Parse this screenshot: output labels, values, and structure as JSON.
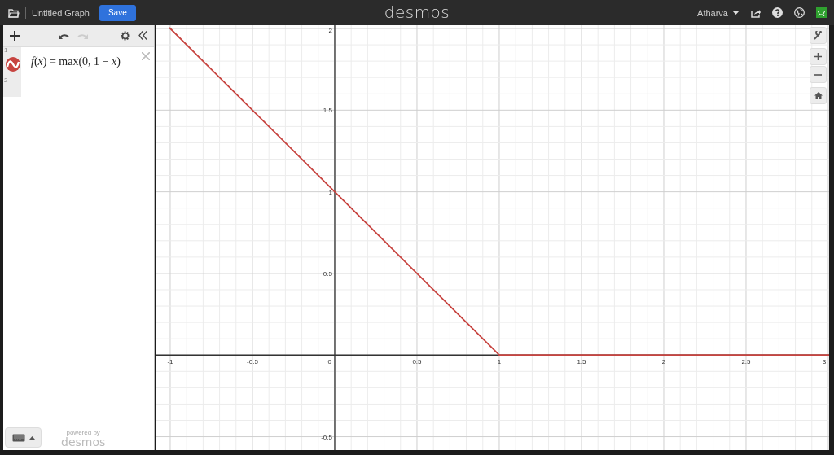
{
  "top_bar": {
    "title": "Untitled Graph",
    "save_button": "Save",
    "logo": "desmos",
    "user": "Atharva"
  },
  "expression_list": {
    "expressions": [
      {
        "number": "1",
        "text": "*f*(*x*) = max(0, 1 − *x*)",
        "color": "#c74440"
      },
      {
        "number": "2"
      }
    ]
  },
  "footer": {
    "powered_by": "powered by",
    "brand": "desmos"
  },
  "graph": {
    "chart_data": {
      "type": "line",
      "grid": true,
      "x": [
        -1.005,
        1,
        3.005
      ],
      "series": [
        {
          "color": "#c74440",
          "values": [
            2.005,
            0,
            0
          ]
        }
      ],
      "xlim": [
        -1.089,
        3.005
      ],
      "ylim": [
        -0.582,
        2.02
      ],
      "xticks": [
        -1,
        -0.5,
        0,
        0.5,
        1,
        1.5,
        2,
        2.5,
        3
      ],
      "yticks": [
        -0.5,
        0.5,
        1,
        1.5,
        2
      ]
    }
  }
}
